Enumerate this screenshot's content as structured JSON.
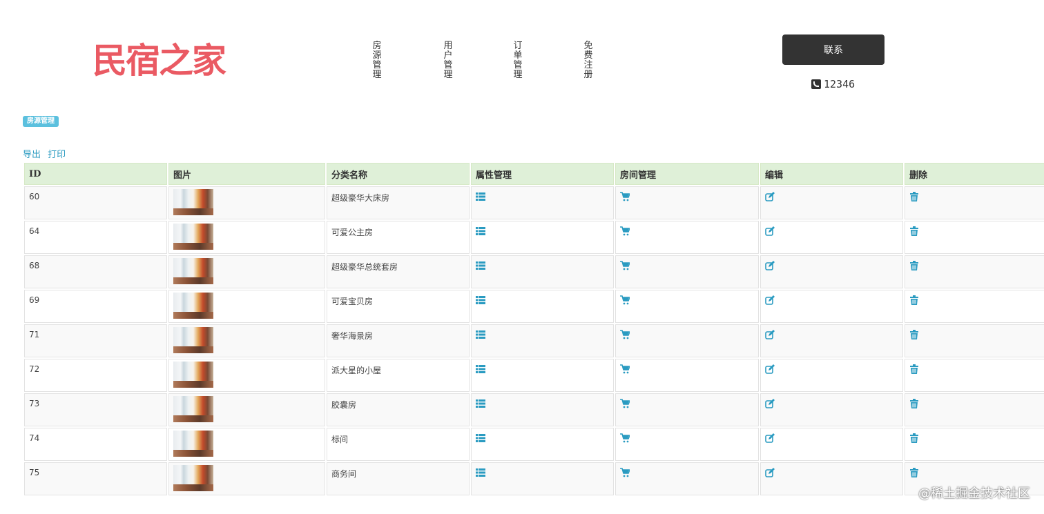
{
  "brand": {
    "logo_text": "民宿之家",
    "color": "#ea5a63"
  },
  "nav": {
    "items": [
      {
        "label": [
          "房",
          "源",
          "管",
          "理"
        ]
      },
      {
        "label": [
          "用",
          "户",
          "管",
          "理"
        ]
      },
      {
        "label": [
          "订",
          "单",
          "管",
          "理"
        ]
      },
      {
        "label": [
          "免",
          "费",
          "注",
          "册"
        ]
      }
    ]
  },
  "contact": {
    "button_label": "联系",
    "phone": "12346",
    "phone_icon": "phone-icon"
  },
  "section": {
    "badge": "房源管理"
  },
  "toolbar": {
    "export_label": "导出",
    "print_label": "打印"
  },
  "table": {
    "headers": [
      "ID",
      "图片",
      "分类名称",
      "属性管理",
      "房间管理",
      "编辑",
      "删除"
    ],
    "rows": [
      {
        "id": "60",
        "name": "超级豪华大床房"
      },
      {
        "id": "64",
        "name": "可爱公主房"
      },
      {
        "id": "68",
        "name": "超级豪华总统套房"
      },
      {
        "id": "69",
        "name": "可爱宝贝房"
      },
      {
        "id": "71",
        "name": "奢华海景房"
      },
      {
        "id": "72",
        "name": "派大星的小屋"
      },
      {
        "id": "73",
        "name": "胶囊房"
      },
      {
        "id": "74",
        "name": "标间"
      },
      {
        "id": "75",
        "name": "商务间"
      }
    ],
    "header_bg": "#dff0d8",
    "icon_color": "#2a9bc1",
    "icons": {
      "attr": "list-icon",
      "room": "cart-icon",
      "edit": "edit-icon",
      "delete": "trash-icon"
    }
  },
  "watermark": "@稀土掘金技术社区"
}
